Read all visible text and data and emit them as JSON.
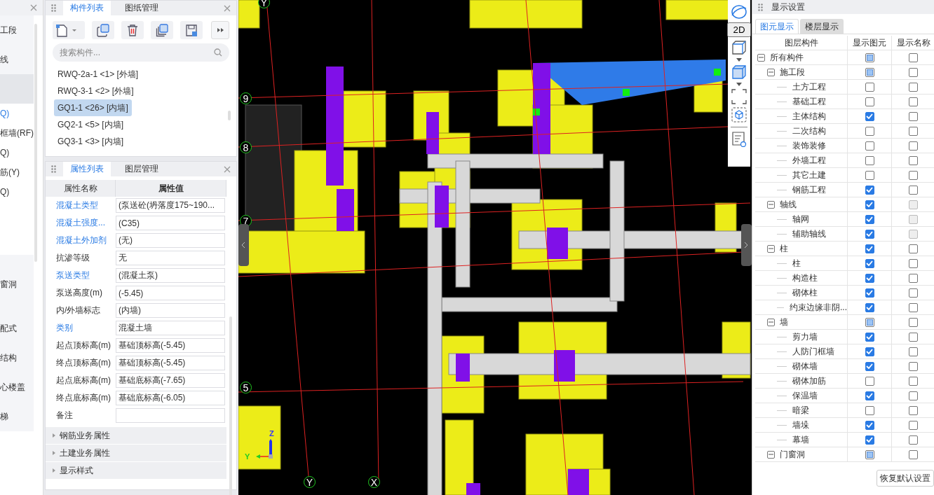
{
  "left_strip": {
    "sections": [
      {
        "kind": "group",
        "items": [
          {
            "text": "工段",
            "selected": false
          },
          {
            "text": "线",
            "selected": false
          },
          {
            "selected": true
          }
        ]
      },
      {
        "kind": "list",
        "items": [
          {
            "text": "Q)",
            "selected": true
          },
          {
            "text": "框墙(RF)",
            "selected": false
          },
          {
            "text": "Q)",
            "selected": false
          },
          {
            "text": "筋(Y)",
            "selected": false
          },
          {
            "text": "Q)",
            "selected": false
          }
        ]
      },
      {
        "kind": "group",
        "items": [
          {
            "text": "窗洞",
            "selected": false
          },
          {
            "text": "配式",
            "selected": false
          },
          {
            "text": "结构",
            "selected": false
          },
          {
            "text": "心楼盖",
            "selected": false
          },
          {
            "text": "梯",
            "selected": false
          }
        ]
      }
    ]
  },
  "component_panel": {
    "tabs": [
      {
        "label": "构件列表",
        "selected": true
      },
      {
        "label": "图纸管理",
        "selected": false
      }
    ],
    "search": {
      "placeholder": "搜索构件..."
    },
    "components": [
      {
        "label": "RWQ-2a-1 <1> [外墙]",
        "selected": false
      },
      {
        "label": "RWQ-3-1 <2> [外墙]",
        "selected": false
      },
      {
        "label": "GQ1-1 <26> [内墙]",
        "selected": true
      },
      {
        "label": "GQ2-1 <5> [内墙]",
        "selected": false
      },
      {
        "label": "GQ3-1 <3> [内墙]",
        "selected": false
      }
    ]
  },
  "property_panel": {
    "tabs": [
      {
        "label": "属性列表",
        "selected": true
      },
      {
        "label": "图层管理",
        "selected": false
      }
    ],
    "columns": [
      "属性名称",
      "属性值"
    ],
    "rows": [
      {
        "name": "混凝土类型",
        "value": "(泵送砼(坍落度175~190...",
        "linked": true
      },
      {
        "name": "混凝土强度...",
        "value": "(C35)",
        "linked": true
      },
      {
        "name": "混凝土外加剂",
        "value": "(无)",
        "linked": true
      },
      {
        "name": "抗渗等级",
        "value": "无",
        "linked": false
      },
      {
        "name": "泵送类型",
        "value": "(混凝土泵)",
        "linked": true
      },
      {
        "name": "泵送高度(m)",
        "value": "(-5.45)",
        "linked": false
      },
      {
        "name": "内/外墙标志",
        "value": "(内墙)",
        "linked": false
      },
      {
        "name": "类别",
        "value": "混凝土墙",
        "linked": true
      },
      {
        "name": "起点顶标高(m)",
        "value": "基础顶标高(-5.45)",
        "linked": false
      },
      {
        "name": "终点顶标高(m)",
        "value": "基础顶标高(-5.45)",
        "linked": false
      },
      {
        "name": "起点底标高(m)",
        "value": "基础底标高(-7.65)",
        "linked": false
      },
      {
        "name": "终点底标高(m)",
        "value": "基础底标高(-6.05)",
        "linked": false
      },
      {
        "name": "备注",
        "linked": false
      }
    ],
    "sections": [
      {
        "label": "钢筋业务属性",
        "expanded": false
      },
      {
        "label": "土建业务属性",
        "expanded": false
      },
      {
        "label": "显示样式",
        "expanded": false
      }
    ]
  },
  "viewport": {
    "row_bubbles": [
      "9",
      "8",
      "7",
      "5"
    ],
    "top_bubbles": [
      "Y"
    ],
    "column_bubbles": [
      "Y",
      "X"
    ],
    "view_2d_label": "2D",
    "triad": {
      "z": "Z",
      "y": "Y"
    }
  },
  "display_settings": {
    "title": "显示设置",
    "tabs": [
      {
        "label": "图元显示",
        "selected": true
      },
      {
        "label": "楼层显示",
        "selected": false
      }
    ],
    "columns": [
      "图层构件",
      "显示图元",
      "显示名称"
    ],
    "tree": [
      {
        "label": "所有构件",
        "expanded": true,
        "checked": false,
        "partial": true,
        "name_shown": false,
        "name_disabled": false,
        "children": [
          {
            "label": "施工段",
            "expanded": true,
            "checked": false,
            "partial": true,
            "name_shown": false,
            "name_disabled": false,
            "children": [
              {
                "label": "土方工程",
                "checked": false,
                "partial": false,
                "name_shown": false,
                "name_disabled": false
              },
              {
                "label": "基础工程",
                "checked": false,
                "partial": false,
                "name_shown": false,
                "name_disabled": false
              },
              {
                "label": "主体结构",
                "checked": true,
                "partial": false,
                "name_shown": false,
                "name_disabled": false
              },
              {
                "label": "二次结构",
                "checked": false,
                "partial": false,
                "name_shown": false,
                "name_disabled": false
              },
              {
                "label": "装饰装修",
                "checked": false,
                "partial": false,
                "name_shown": false,
                "name_disabled": false
              },
              {
                "label": "外墙工程",
                "checked": false,
                "partial": false,
                "name_shown": false,
                "name_disabled": false
              },
              {
                "label": "其它土建",
                "checked": false,
                "partial": false,
                "name_shown": false,
                "name_disabled": false
              },
              {
                "label": "钢筋工程",
                "checked": true,
                "partial": false,
                "name_shown": false,
                "name_disabled": false
              }
            ]
          },
          {
            "label": "轴线",
            "expanded": true,
            "checked": true,
            "partial": false,
            "name_shown": false,
            "name_disabled": true,
            "children": [
              {
                "label": "轴网",
                "checked": true,
                "partial": false,
                "name_shown": false,
                "name_disabled": true
              },
              {
                "label": "辅助轴线",
                "checked": true,
                "partial": false,
                "name_shown": false,
                "name_disabled": true
              }
            ]
          },
          {
            "label": "柱",
            "expanded": true,
            "checked": true,
            "partial": false,
            "name_shown": false,
            "name_disabled": false,
            "children": [
              {
                "label": "柱",
                "checked": true,
                "partial": false,
                "name_shown": false,
                "name_disabled": false
              },
              {
                "label": "构造柱",
                "checked": true,
                "partial": false,
                "name_shown": false,
                "name_disabled": false
              },
              {
                "label": "砌体柱",
                "checked": true,
                "partial": false,
                "name_shown": false,
                "name_disabled": false
              },
              {
                "label": "约束边缘非阴...",
                "checked": true,
                "partial": false,
                "name_shown": false,
                "name_disabled": false
              }
            ]
          },
          {
            "label": "墙",
            "expanded": true,
            "checked": false,
            "partial": true,
            "name_shown": false,
            "name_disabled": false,
            "children": [
              {
                "label": "剪力墙",
                "checked": true,
                "partial": false,
                "name_shown": false,
                "name_disabled": false
              },
              {
                "label": "人防门框墙",
                "checked": true,
                "partial": false,
                "name_shown": false,
                "name_disabled": false
              },
              {
                "label": "砌体墙",
                "checked": true,
                "partial": false,
                "name_shown": false,
                "name_disabled": false
              },
              {
                "label": "砌体加筋",
                "checked": false,
                "partial": false,
                "name_shown": false,
                "name_disabled": false
              },
              {
                "label": "保温墙",
                "checked": true,
                "partial": false,
                "name_shown": false,
                "name_disabled": false
              },
              {
                "label": "暗梁",
                "checked": false,
                "partial": false,
                "name_shown": false,
                "name_disabled": false
              },
              {
                "label": "墙垛",
                "checked": true,
                "partial": false,
                "name_shown": false,
                "name_disabled": false
              },
              {
                "label": "幕墙",
                "checked": true,
                "partial": false,
                "name_shown": false,
                "name_disabled": false
              }
            ]
          },
          {
            "label": "门窗洞",
            "expanded": true,
            "checked": false,
            "partial": true,
            "name_shown": false,
            "name_disabled": false
          }
        ]
      }
    ],
    "reset_button": "恢复默认设置"
  }
}
